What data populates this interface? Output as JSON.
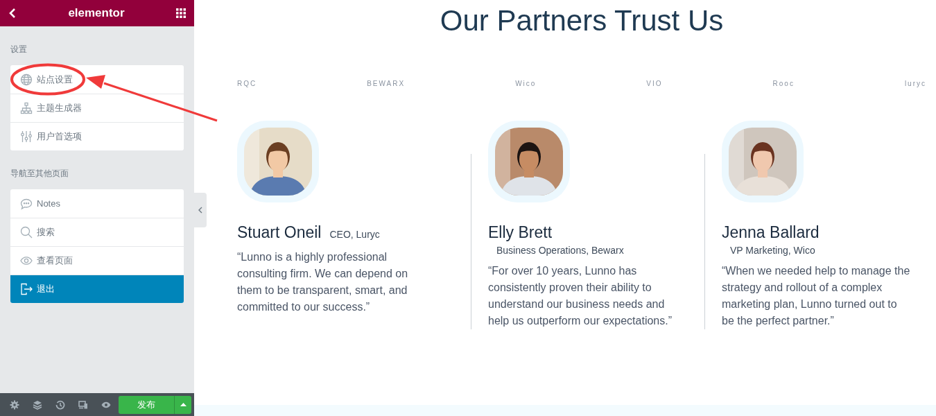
{
  "panel": {
    "logo": "elementor",
    "sections": [
      {
        "title": "设置",
        "items": [
          {
            "label": "站点设置",
            "selected": false
          },
          {
            "label": "主题生成器",
            "selected": false
          },
          {
            "label": "用户首选项",
            "selected": false
          }
        ]
      },
      {
        "title": "导航至其他页面",
        "items": [
          {
            "label": "Notes",
            "selected": false
          },
          {
            "label": "搜索",
            "selected": false
          },
          {
            "label": "查看页面",
            "selected": false
          },
          {
            "label": "退出",
            "selected": true
          }
        ]
      }
    ],
    "footer": {
      "publish": "发布"
    }
  },
  "page": {
    "heading": "Our Partners Trust Us",
    "logos": [
      "RQC",
      "BEWARX",
      "Wico",
      "VIO",
      "Rooc",
      "luryc"
    ],
    "testimonials": [
      {
        "name": "Stuart Oneil",
        "role": "CEO, Luryc",
        "role_inline": true,
        "quote": "“Lunno is a highly professional consulting firm. We can depend on them to be transparent, smart, and committed to our success.”"
      },
      {
        "name": "Elly Brett",
        "role": "Business Operations, Bewarx",
        "role_inline": false,
        "quote": "“For over 10 years, Lunno has consistently proven their ability to understand our business needs and help us outperform our expectations.”"
      },
      {
        "name": "Jenna Ballard",
        "role": "VP Marketing, Wico",
        "role_inline": false,
        "quote": "“When we needed help to manage the strategy and rollout of a complex marketing plan, Lunno turned out to be the perfect partner.”"
      }
    ]
  }
}
